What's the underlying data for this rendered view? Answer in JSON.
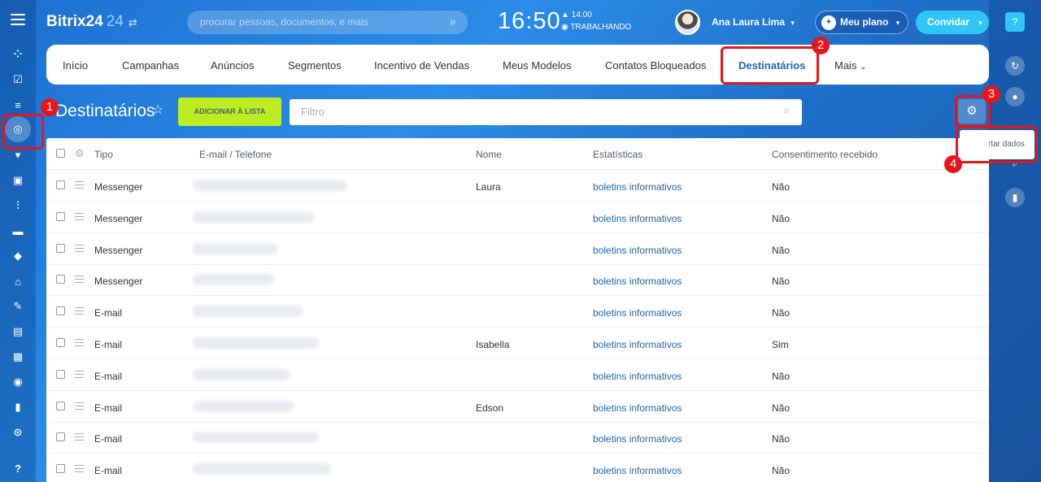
{
  "header": {
    "logo_name": "Bitrix24",
    "logo_num": "24",
    "search_placeholder": "procurar pessoas, documentos, e mais",
    "clock": "16:50",
    "work_time": "▲ 14:00",
    "work_status": "◉ TRABALHANDO",
    "user_name": "Ana Laura Lima",
    "plan_label": "Meu plano",
    "invite_label": "Convidar"
  },
  "topnav": {
    "items": [
      "Início",
      "Campanhas",
      "Anúncios",
      "Segmentos",
      "Incentivo de Vendas",
      "Meus Modelos",
      "Contatos Bloqueados",
      "Destinatários",
      "Mais"
    ],
    "active_index": 7
  },
  "page": {
    "title": "Destinatários",
    "add_button": "ADICIONAR À LISTA",
    "filter_placeholder": "Filtro",
    "export_label": "Exportar dados"
  },
  "markers": [
    "1",
    "2",
    "3",
    "4"
  ],
  "table": {
    "columns": [
      "Tipo",
      "E-mail / Telefone",
      "Nome",
      "Estatísticas",
      "Consentimento recebido"
    ],
    "rows": [
      {
        "tipo": "Messenger",
        "nome": "Laura",
        "stat": "boletins informativos",
        "consent": "Não"
      },
      {
        "tipo": "Messenger",
        "nome": "",
        "stat": "boletins informativos",
        "consent": "Não"
      },
      {
        "tipo": "Messenger",
        "nome": "",
        "stat": "boletins informativos",
        "consent": "Não"
      },
      {
        "tipo": "Messenger",
        "nome": "",
        "stat": "boletins informativos",
        "consent": "Não"
      },
      {
        "tipo": "E-mail",
        "nome": "",
        "stat": "boletins informativos",
        "consent": "Não"
      },
      {
        "tipo": "E-mail",
        "nome": "Isabella",
        "stat": "boletins informativos",
        "consent": "Sim"
      },
      {
        "tipo": "E-mail",
        "nome": "",
        "stat": "boletins informativos",
        "consent": "Não"
      },
      {
        "tipo": "E-mail",
        "nome": "Edson",
        "stat": "boletins informativos",
        "consent": "Não"
      },
      {
        "tipo": "E-mail",
        "nome": "",
        "stat": "boletins informativos",
        "consent": "Não"
      },
      {
        "tipo": "E-mail",
        "nome": "",
        "stat": "boletins informativos",
        "consent": "Não"
      }
    ]
  },
  "colors": {
    "accent": "#2067b0",
    "add_button": "#bbed21",
    "invite_button": "#2fc6f6",
    "highlight": "#e8161a"
  },
  "icons": {
    "left_sidebar": [
      "menu-icon",
      "feed-icon",
      "tasks-icon",
      "list-icon",
      "marketing-icon",
      "shop-icon",
      "contact-icon",
      "analytics-icon",
      "robot-icon",
      "box-icon",
      "bank-icon",
      "sign-icon",
      "doc-icon",
      "calendar-icon",
      "target-icon",
      "chat-icon",
      "more-icon",
      "help-icon"
    ],
    "right_sidebar": [
      "help-icon",
      "history-icon",
      "bell-icon",
      "search-icon",
      "bookmark-icon"
    ]
  }
}
